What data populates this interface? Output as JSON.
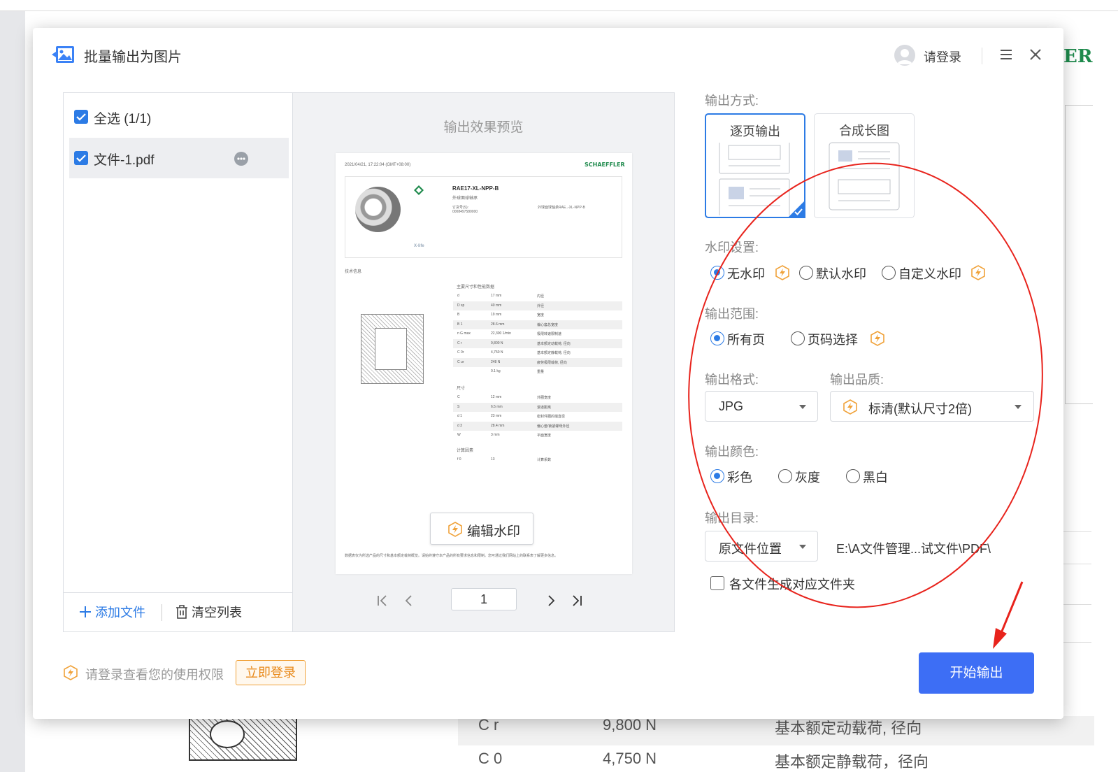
{
  "dialog": {
    "title": "批量输出为图片",
    "login_label": "请登录"
  },
  "file_list": {
    "select_all": "全选 (1/1)",
    "files": [
      {
        "name": "文件-1.pdf",
        "checked": true
      }
    ],
    "add_file": "添加文件",
    "clear_list": "清空列表"
  },
  "preview": {
    "title": "输出效果预览",
    "edit_watermark": "编辑水印",
    "current_page": "1",
    "pdf": {
      "timestamp": "2021/04/21, 17:22:04 (GMT+08:00)",
      "brand": "SCHAEFFLER",
      "product_code": "RAE17-XL-NPP-B",
      "product_desc": "外球面球轴承",
      "order_label": "订货号(S):",
      "order_no": "0008497580000",
      "product_note": "外球面球轴承RAE..-XL-NPP-B",
      "xlife": "X-life",
      "tech_info": "技术信息",
      "main_dims_title": "主要尺寸和性能数据",
      "main_dims": [
        [
          "d",
          "17  mm",
          "内径"
        ],
        [
          "D sp",
          "40  mm",
          "外径"
        ],
        [
          "B",
          "19  mm",
          "宽度"
        ],
        [
          "B 1",
          "28.6  mm",
          "偏心套总宽度"
        ],
        [
          "n G max",
          "22,300  1/min",
          "极限转速限制速"
        ],
        [
          "C r",
          "9,800  N",
          "基本额定动载荷, 径向"
        ],
        [
          "C 0r",
          "4,750  N",
          "基本额定静载荷, 径向"
        ],
        [
          "C ur",
          "248  N",
          "疲劳极限载荷, 径向"
        ],
        [
          "",
          "0.1  kg",
          "重量"
        ]
      ],
      "dims_title": "尺寸",
      "dims": [
        [
          "C",
          "12  mm",
          "外圈宽度"
        ],
        [
          "S",
          "6.5  mm",
          "滚道距离"
        ],
        [
          "d 1",
          "23  mm",
          "密封件圈的端直径"
        ],
        [
          "d 3",
          "28.4  mm",
          "偏心套/锁紧螺母外径"
        ],
        [
          "W",
          "3  mm",
          "平面宽度"
        ]
      ],
      "calc_title": "计算因素",
      "calc": [
        [
          "f 0",
          "13",
          "计算系数"
        ]
      ],
      "footer_note": "数据表仅为所选产品的尺寸和基本额定载荷概览。请始终遵守本产品的所有要求信息和限制。您可通过我们网站上的联系表了解更多信息。"
    }
  },
  "settings": {
    "output_mode_label": "输出方式:",
    "modes": [
      {
        "label": "逐页输出",
        "selected": true
      },
      {
        "label": "合成长图",
        "selected": false
      }
    ],
    "watermark_label": "水印设置:",
    "watermark_options": [
      {
        "label": "无水印",
        "selected": true,
        "vip": true
      },
      {
        "label": "默认水印",
        "selected": false,
        "vip": false
      },
      {
        "label": "自定义水印",
        "selected": false,
        "vip": true
      }
    ],
    "range_label": "输出范围:",
    "range_options": [
      {
        "label": "所有页",
        "selected": true,
        "vip": false
      },
      {
        "label": "页码选择",
        "selected": false,
        "vip": true
      }
    ],
    "format_label": "输出格式:",
    "format_value": "JPG",
    "quality_label": "输出品质:",
    "quality_value": "标清(默认尺寸2倍)",
    "color_label": "输出颜色:",
    "color_options": [
      {
        "label": "彩色",
        "selected": true
      },
      {
        "label": "灰度",
        "selected": false
      },
      {
        "label": "黑白",
        "selected": false
      }
    ],
    "dir_label": "输出目录:",
    "dir_value": "原文件位置",
    "dir_path": "E:\\A文件管理...试文件\\PDF\\",
    "per_file_folder": "各文件生成对应文件夹"
  },
  "footer": {
    "tip": "请登录查看您的使用权限",
    "login_now": "立即登录",
    "start": "开始输出"
  },
  "background": {
    "er": "ER",
    "row_symbol": "C r",
    "row_value": "9,800  N",
    "row_desc": "基本额定动载荷, 径向",
    "row2_symbol": "C 0",
    "row2_value": "4,750  N",
    "row2_desc": "基本额定静载荷，径向"
  },
  "colors": {
    "accent": "#2c7be5",
    "start_button": "#3d6ef5",
    "vip": "#f0a23a",
    "annotation": "#e8231c",
    "brand_green": "#1e8a4c"
  }
}
